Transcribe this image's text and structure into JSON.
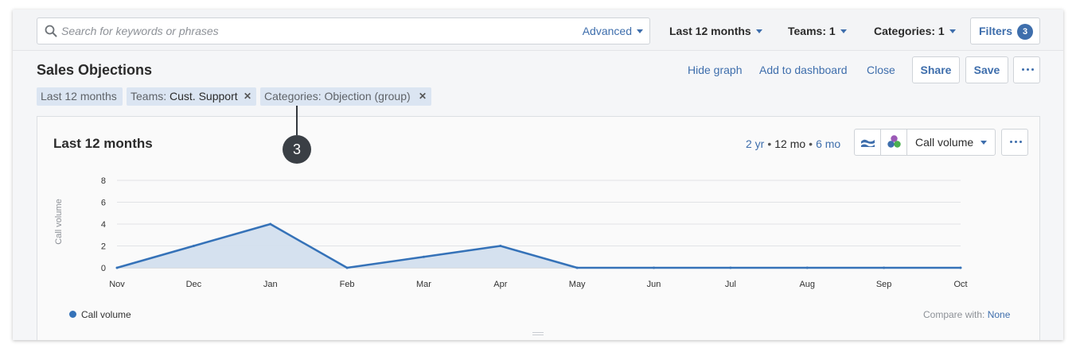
{
  "search": {
    "placeholder": "Search for keywords or phrases",
    "advanced_label": "Advanced"
  },
  "top_filters": {
    "date_label": "Last 12 months",
    "teams_label": "Teams: 1",
    "categories_label": "Categories: 1",
    "filters_label": "Filters",
    "filters_count": "3"
  },
  "header": {
    "title": "Sales Objections",
    "hide_graph": "Hide graph",
    "add_to_dashboard": "Add to dashboard",
    "close": "Close",
    "share": "Share",
    "save": "Save"
  },
  "chips": [
    {
      "label": "Last 12 months",
      "value": ""
    },
    {
      "label": "Teams:",
      "value": "Cust. Support"
    },
    {
      "label": "Categories: Objection (group)",
      "value": ""
    }
  ],
  "callout_number": "3",
  "card": {
    "title": "Last 12 months",
    "range_options": [
      "2 yr",
      "12 mo",
      "6 mo"
    ],
    "range_selected": "12 mo",
    "metric_label": "Call volume",
    "legend_label": "Call volume",
    "compare_label": "Compare with:",
    "compare_value": "None"
  },
  "colors": {
    "accent": "#3e6eac",
    "series": "#3572b8",
    "area": "#d3dfee"
  },
  "icons": {
    "search": "search-icon",
    "stack": "stacked-area-icon",
    "circles": "color-circles-icon",
    "more": "more-horizontal-icon"
  },
  "chart_data": {
    "type": "area",
    "categories": [
      "Nov",
      "Dec",
      "Jan",
      "Feb",
      "Mar",
      "Apr",
      "May",
      "Jun",
      "Jul",
      "Aug",
      "Sep",
      "Oct"
    ],
    "series": [
      {
        "name": "Call volume",
        "values": [
          0,
          2,
          4,
          0,
          1,
          2,
          0,
          0,
          0,
          0,
          0,
          0
        ]
      }
    ],
    "ylabel": "Call volume",
    "xlabel": "",
    "ylim": [
      0,
      8
    ],
    "yticks": [
      "0",
      "2",
      "4",
      "6",
      "8"
    ],
    "grid": true,
    "legend": "bottom-left"
  }
}
